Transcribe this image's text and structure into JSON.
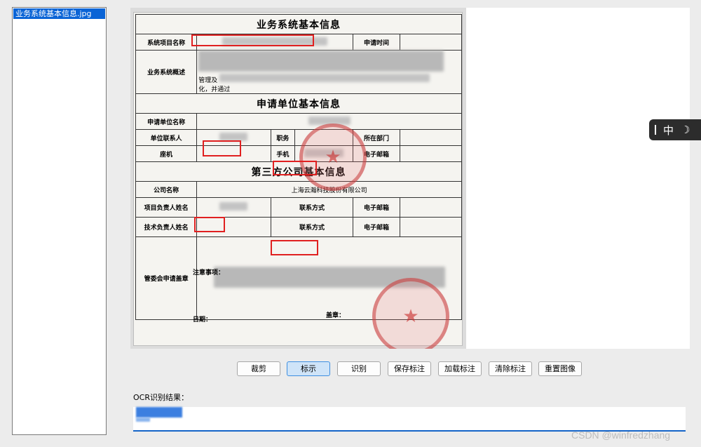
{
  "file_list": {
    "items": [
      {
        "label": "业务系统基本信息.jpg",
        "selected": true
      }
    ]
  },
  "document": {
    "title": "业务系统基本信息",
    "row_system_name": "系统项目名称",
    "row_apply_time": "申请时间",
    "row_overview": "业务系统概述",
    "overview_fragment_1": "管理及",
    "overview_fragment_2": "化，并通过",
    "section_applicant": "申请单位基本信息",
    "row_applicant_name": "申请单位名称",
    "row_contact": "单位联系人",
    "row_position": "职务",
    "row_department": "所在部门",
    "row_landline": "座机",
    "row_mobile": "手机",
    "row_email": "电子邮箱",
    "section_third_party": "第三方公司基本信息",
    "row_company_name": "公司名称",
    "company_name_value": "上海云瀚科技股份有限公司",
    "row_project_lead": "项目负责人姓名",
    "row_contact_method": "联系方式",
    "row_tech_lead": "技术负责人姓名",
    "row_committee": "管委会申请盖章",
    "notes_label": "注意事项：",
    "date_label": "日期：",
    "seal_label": "盖章："
  },
  "toolbar": {
    "buttons": [
      {
        "label": "裁剪",
        "active": false
      },
      {
        "label": "标示",
        "active": true
      },
      {
        "label": "识别",
        "active": false
      },
      {
        "label": "保存标注",
        "active": false
      },
      {
        "label": "加载标注",
        "active": false
      },
      {
        "label": "清除标注",
        "active": false
      },
      {
        "label": "重置图像",
        "active": false
      }
    ]
  },
  "ocr": {
    "label": "OCR识别结果："
  },
  "ime": {
    "mode": "中"
  },
  "watermark": "CSDN @winfredzhang",
  "colors": {
    "accent": "#1464c8",
    "annotation": "#e02020",
    "selection": "#0a64d6"
  }
}
